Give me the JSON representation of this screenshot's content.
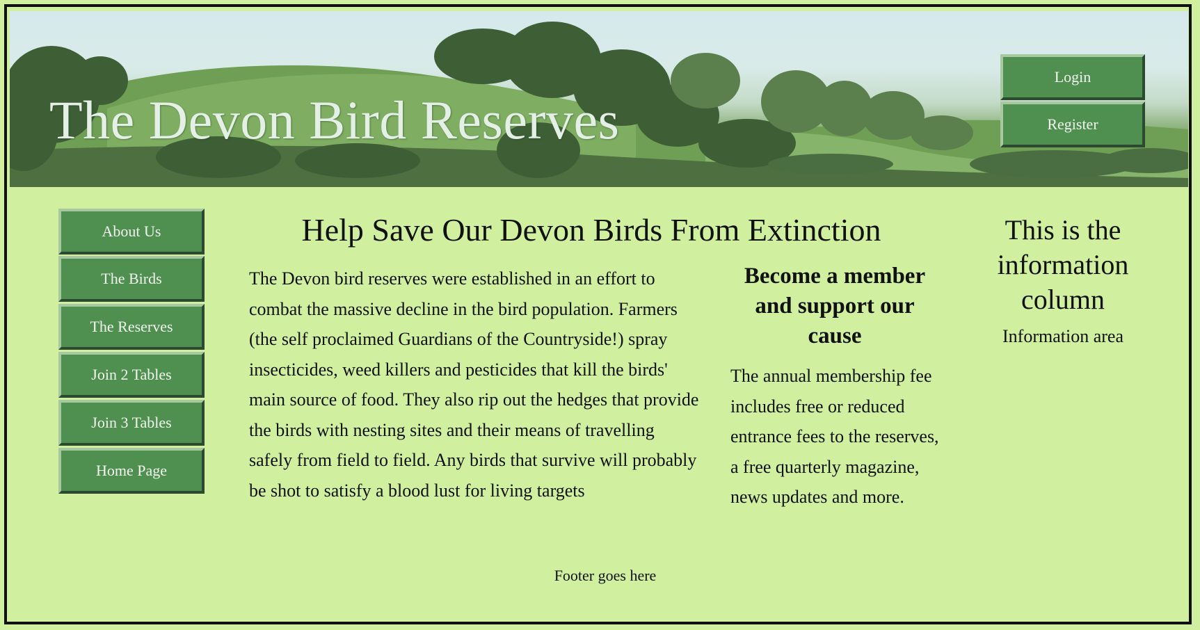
{
  "header": {
    "title": "The Devon Bird Reserves",
    "login_label": "Login",
    "register_label": "Register"
  },
  "nav": {
    "items": [
      {
        "label": "About Us"
      },
      {
        "label": "The Birds"
      },
      {
        "label": "The Reserves"
      },
      {
        "label": "Join 2 Tables"
      },
      {
        "label": "Join 3 Tables"
      },
      {
        "label": "Home Page"
      }
    ]
  },
  "main": {
    "heading": "Help Save Our Devon Birds From Extinction",
    "body": "The Devon bird reserves were established in an effort to combat the massive decline in the bird population. Farmers (the self proclaimed Guardians of the Countryside!) spray insecticides, weed killers and pesticides that kill the birds' main source of food. They also rip out the hedges that provide the birds with nesting sites and their means of travelling safely from field to field. Any birds that survive will probably be shot to satisfy a blood lust for living targets"
  },
  "member": {
    "heading": "Become a member and support our cause",
    "body": "The annual membership fee includes free or reduced entrance fees to the reserves, a free quarterly magazine, news updates and more."
  },
  "info": {
    "heading": "This is the information column",
    "text": "Information area"
  },
  "footer": {
    "text": "Footer goes here"
  },
  "colors": {
    "page_background": "#d0f0a0",
    "button_green": "#4f9050",
    "border": "#111111"
  }
}
